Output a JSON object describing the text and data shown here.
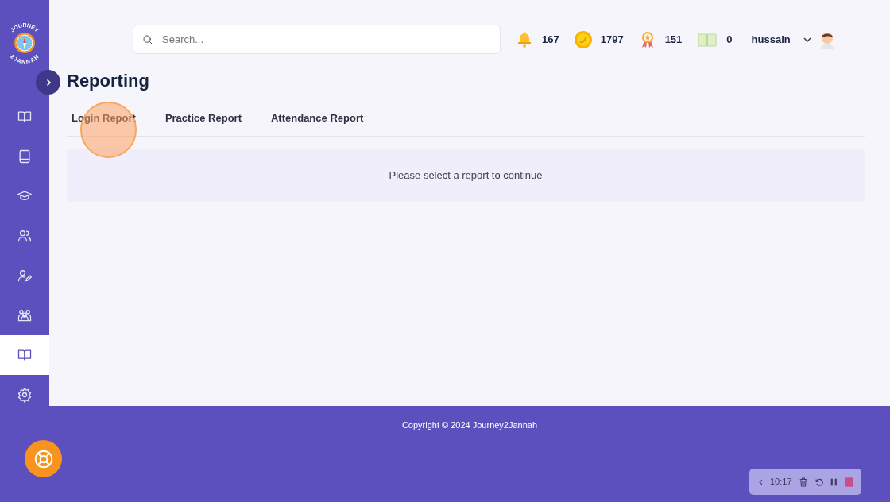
{
  "logo": {
    "top": "JOURNEY",
    "bottom": "2JANNAH"
  },
  "sidebar": {
    "items": [
      {
        "kind": "book-open",
        "selected": false
      },
      {
        "kind": "book",
        "selected": false
      },
      {
        "kind": "cap",
        "selected": false
      },
      {
        "kind": "users",
        "selected": false
      },
      {
        "kind": "user-edit",
        "selected": false
      },
      {
        "kind": "group",
        "selected": false
      },
      {
        "kind": "book-open",
        "selected": true
      },
      {
        "kind": "gear",
        "selected": false
      }
    ]
  },
  "search": {
    "placeholder": "Search..."
  },
  "stats": [
    {
      "kind": "bell",
      "value": "167"
    },
    {
      "kind": "coin",
      "value": "1797"
    },
    {
      "kind": "medal",
      "value": "151"
    },
    {
      "kind": "book",
      "value": "0"
    }
  ],
  "user": {
    "name": "hussain"
  },
  "page_title": "Reporting",
  "tabs": [
    {
      "label": "Login Report",
      "selected": false
    },
    {
      "label": "Practice Report",
      "selected": false
    },
    {
      "label": "Attendance Report",
      "selected": false
    }
  ],
  "message": "Please select a report to continue",
  "footer": "Copyright © 2024  Journey2Jannah",
  "recorder": {
    "time": "10:17"
  }
}
